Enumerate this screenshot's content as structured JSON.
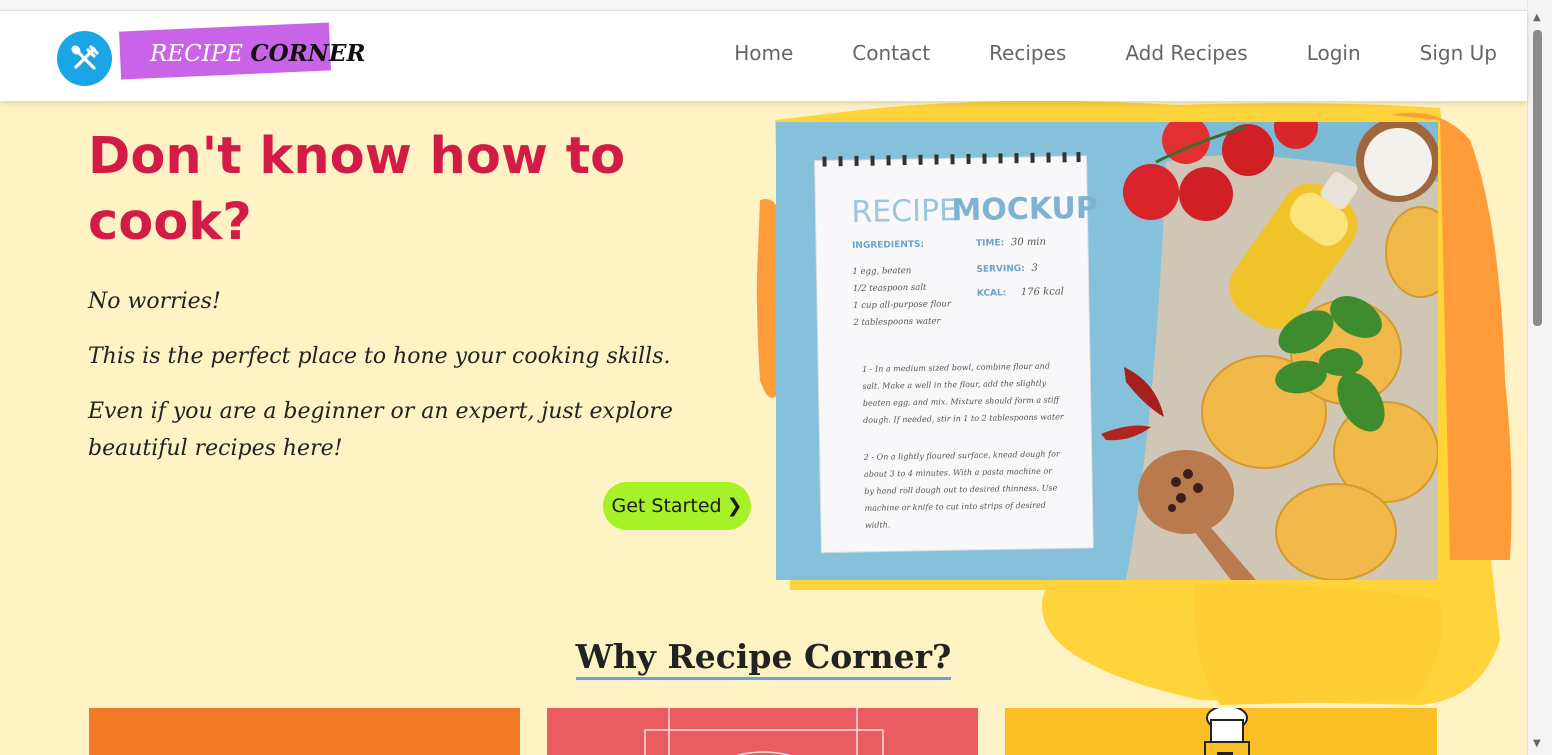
{
  "brand": {
    "name_part1": "RECIPE",
    "name_part2": "CORNER",
    "circle_color": "#1aa6e6",
    "tag_color": "#c964e8"
  },
  "nav": {
    "items": [
      "Home",
      "Contact",
      "Recipes",
      "Add Recipes",
      "Login",
      "Sign Up"
    ]
  },
  "hero": {
    "title": "Don't know how to cook?",
    "lines": [
      "No worries!",
      "This is the perfect place to hone your cooking skills.",
      "Even if you are a beginner or an expert, just explore beautiful recipes here!"
    ],
    "button_label": "Get Started",
    "button_icon": "chevron-right-icon",
    "button_color": "#a6f127",
    "title_color": "#d21c45"
  },
  "mockup": {
    "heading_light": "RECIPE",
    "heading_bold": "MOCKUP",
    "ingredients_label": "INGREDIENTS:",
    "ingredients": [
      "1 egg, beaten",
      "1/2 teaspoon salt",
      "1 cup all-purpose flour",
      "2 tablespoons water"
    ],
    "time_label": "TIME:",
    "time_value": "30 min",
    "serving_label": "SERVING:",
    "serving_value": "3",
    "kcal_label": "KCAL:",
    "kcal_value": "176 kcal",
    "step1_lines": [
      "1 - In a medium sized bowl, combine flour and",
      "salt. Make a well in the flour, add the slightly",
      "beaten egg, and mix. Mixture should form a stiff",
      "dough. If needed, stir in 1 to 2 tablespoons water"
    ],
    "step2_lines": [
      "2 - On a lightly floured surface, knead dough for",
      "about 3 to 4 minutes. With a pasta machine or",
      "by hand roll dough out to desired thinness. Use",
      "machine or knife to cut into strips of desired",
      "width."
    ]
  },
  "why": {
    "title": "Why Recipe Corner?"
  },
  "cards": [
    {
      "color": "#f27a26"
    },
    {
      "color": "#e85c62"
    },
    {
      "color": "#fbbf26"
    }
  ]
}
